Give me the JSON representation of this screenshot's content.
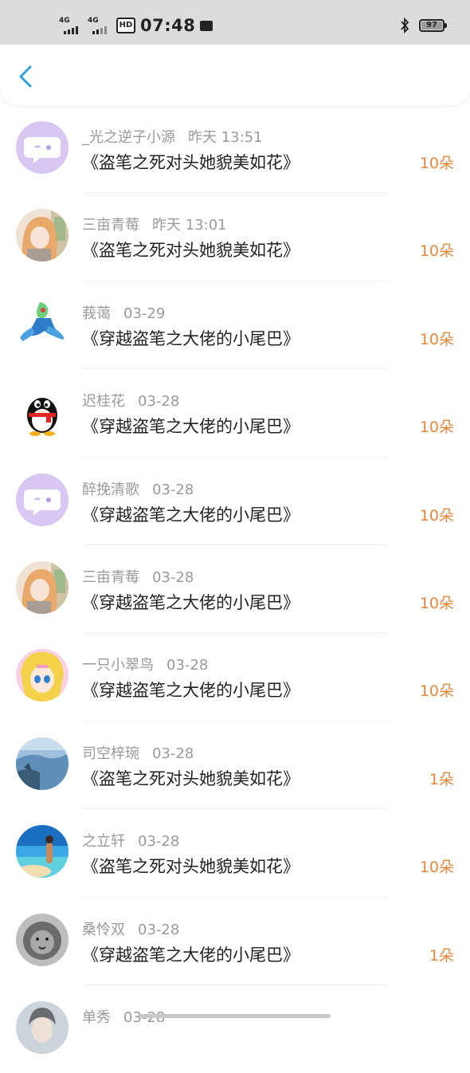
{
  "status": {
    "signal1": "4G",
    "signal2": "4G",
    "hd": "HD",
    "time": "07:48",
    "battery": "97"
  },
  "nav": {
    "back_icon": "chevron-left-icon"
  },
  "colors": {
    "accent": "#2ba2e6",
    "amount": "#e8873a",
    "meta": "#9a9a9a"
  },
  "items": [
    {
      "name": "_光之逆子小源",
      "date": "昨天 13:51",
      "title": "《盗笔之死对头她貌美如花》",
      "amount": "10朵",
      "avatar": "chat-bubble-avatar"
    },
    {
      "name": "三亩青莓",
      "date": "昨天 13:01",
      "title": "《盗笔之死对头她貌美如花》",
      "amount": "10朵",
      "avatar": "anime-girl-avatar"
    },
    {
      "name": "莪蔼",
      "date": "03-29",
      "title": "《穿越盗笔之大佬的小尾巴》",
      "amount": "10朵",
      "avatar": "creature-avatar"
    },
    {
      "name": "迟桂花",
      "date": "03-28",
      "title": "《穿越盗笔之大佬的小尾巴》",
      "amount": "10朵",
      "avatar": "penguin-avatar"
    },
    {
      "name": "醉挽清歌",
      "date": "03-28",
      "title": "《穿越盗笔之大佬的小尾巴》",
      "amount": "10朵",
      "avatar": "chat-bubble-avatar"
    },
    {
      "name": "三亩青莓",
      "date": "03-28",
      "title": "《穿越盗笔之大佬的小尾巴》",
      "amount": "10朵",
      "avatar": "anime-girl-avatar"
    },
    {
      "name": "一只小翠鸟",
      "date": "03-28",
      "title": "《穿越盗笔之大佬的小尾巴》",
      "amount": "10朵",
      "avatar": "sailor-girl-avatar"
    },
    {
      "name": "司空梓琬",
      "date": "03-28",
      "title": "《盗笔之死对头她貌美如花》",
      "amount": "1朵",
      "avatar": "landscape-avatar"
    },
    {
      "name": "之立轩",
      "date": "03-28",
      "title": "《盗笔之死对头她貌美如花》",
      "amount": "10朵",
      "avatar": "beach-avatar"
    },
    {
      "name": "桑怜双",
      "date": "03-28",
      "title": "《穿越盗笔之大佬的小尾巴》",
      "amount": "1朵",
      "avatar": "lion-avatar"
    },
    {
      "name": "单秀",
      "date": "03-28",
      "title": "",
      "amount": "",
      "avatar": "portrait-avatar"
    }
  ]
}
